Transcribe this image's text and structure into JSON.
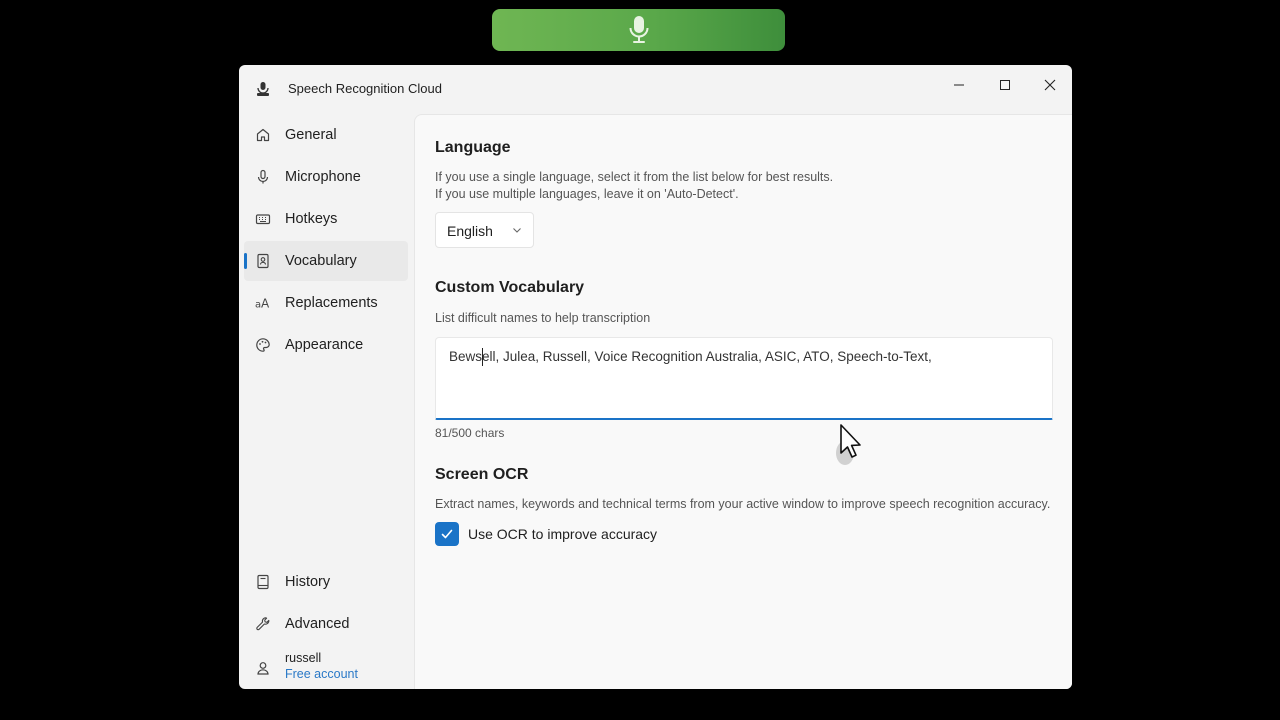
{
  "app": {
    "title": "Speech Recognition Cloud"
  },
  "sidebar": {
    "items": [
      {
        "label": "General",
        "icon": "home-icon"
      },
      {
        "label": "Microphone",
        "icon": "microphone-icon"
      },
      {
        "label": "Hotkeys",
        "icon": "keyboard-icon"
      },
      {
        "label": "Vocabulary",
        "icon": "contact-book-icon",
        "active": true
      },
      {
        "label": "Replacements",
        "icon": "text-case-icon"
      },
      {
        "label": "Appearance",
        "icon": "palette-icon"
      }
    ],
    "bottom_items": [
      {
        "label": "History",
        "icon": "book-icon"
      },
      {
        "label": "Advanced",
        "icon": "wrench-icon"
      }
    ],
    "user": {
      "name": "russell",
      "plan": "Free account"
    }
  },
  "language": {
    "title": "Language",
    "desc_line1": "If you use a single language, select it from the list below for best results.",
    "desc_line2": "If you use multiple languages, leave it on 'Auto-Detect'.",
    "selected": "English"
  },
  "vocabulary": {
    "title": "Custom Vocabulary",
    "desc": "List difficult names to help transcription",
    "value": "Bewsell, Julea, Russell, Voice Recognition Australia, ASIC, ATO, Speech-to-Text,",
    "char_count": "81/500 chars"
  },
  "ocr": {
    "title": "Screen OCR",
    "desc": "Extract names, keywords and technical terms from your active window to improve speech recognition accuracy.",
    "checkbox_label": "Use OCR to improve accuracy",
    "checked": true
  },
  "colors": {
    "accent": "#1a73c7",
    "mic_pill": "#5aa84a"
  }
}
